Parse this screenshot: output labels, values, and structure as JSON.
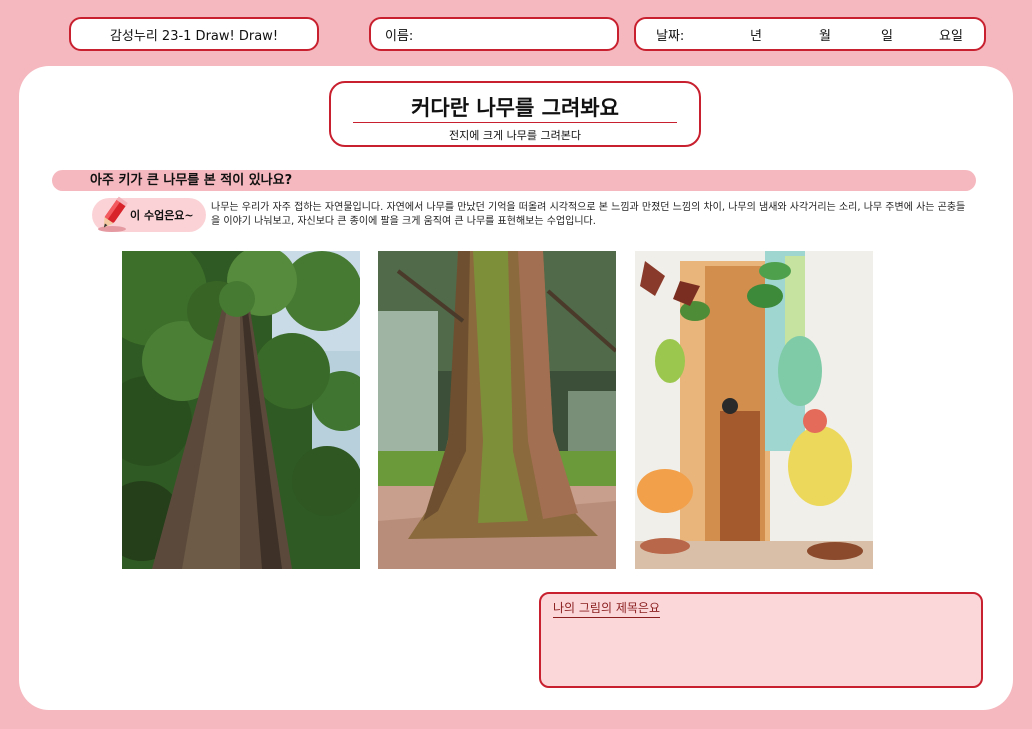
{
  "header": {
    "class_label": "감성누리 23-1 Draw! Draw!",
    "name_label": "이름:",
    "date_label": "날짜:",
    "year_label": "년",
    "month_label": "월",
    "day_label": "일",
    "weekday_label": "요일"
  },
  "title": {
    "main": "커다란 나무를 그려봐요",
    "sub": "전지에 크게 나무를 그려본다"
  },
  "question": "아주 키가 큰 나무를 본 적이 있나요?",
  "lesson_badge": "이 수업은요~",
  "description": "나무는 우리가 자주 접하는 자연물입니다. 자연에서 나무를 만났던 기억을 떠올려 시각적으로 본 느낌과 만졌던 느낌의 차이, 나무의 냄새와 사각거리는 소리, 나무 주변에 사는 곤충들을 이야기 나눠보고, 자신보다 큰 종이에 팔을 크게 움직여 큰 나무를 표현해보는 수업입니다.",
  "answer_box": {
    "label": "나의 그림의 제목은요"
  },
  "colors": {
    "background": "#f5b8bf",
    "accent_red": "#c8202e",
    "answer_fill": "#fbd7da"
  }
}
